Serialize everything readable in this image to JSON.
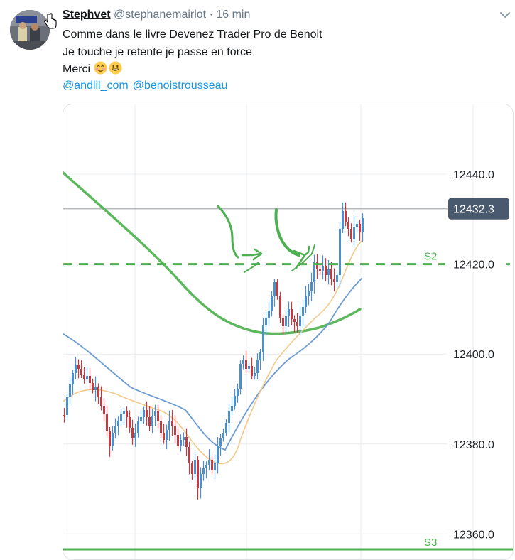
{
  "tweet": {
    "author_name": "Stephvet",
    "handle": "@stephanemairlot",
    "separator": "·",
    "time": "16 min",
    "lines": [
      "Comme dans le livre Devenez Trader Pro de Benoit",
      "Je touche je retente je passe en force",
      "Merci"
    ],
    "emojis": [
      "smiling-face-with-blush-icon",
      "grinning-face-icon"
    ],
    "mentions": [
      "@andlil_com",
      "@benoistrousseau"
    ],
    "menu_icon": "chevron-down-icon"
  },
  "colors": {
    "link": "#1b95e0",
    "text": "#14171a",
    "muted": "#657786",
    "price_label_bg": "#4a5a6e",
    "support_green": "#4caf50",
    "candle_up": "#4a8fd4",
    "candle_down": "#c8383e",
    "ma_blue": "#6b9bd2",
    "ma_orange": "#f2c98a",
    "ma_green": "#5cb85c"
  },
  "chart_data": {
    "type": "candlestick",
    "y_ticks": [
      "12440.0",
      "12420.0",
      "12400.0",
      "12380.0",
      "12360.0"
    ],
    "y_tick_values": [
      12440,
      12420,
      12400,
      12380,
      12360
    ],
    "ylim": [
      12357.5,
      12459.5
    ],
    "current_price_label": "12432.3",
    "current_price": 12432.3,
    "levels": [
      {
        "name": "S2",
        "value": 12420
      },
      {
        "name": "S3",
        "value": 12357.5
      }
    ]
  }
}
